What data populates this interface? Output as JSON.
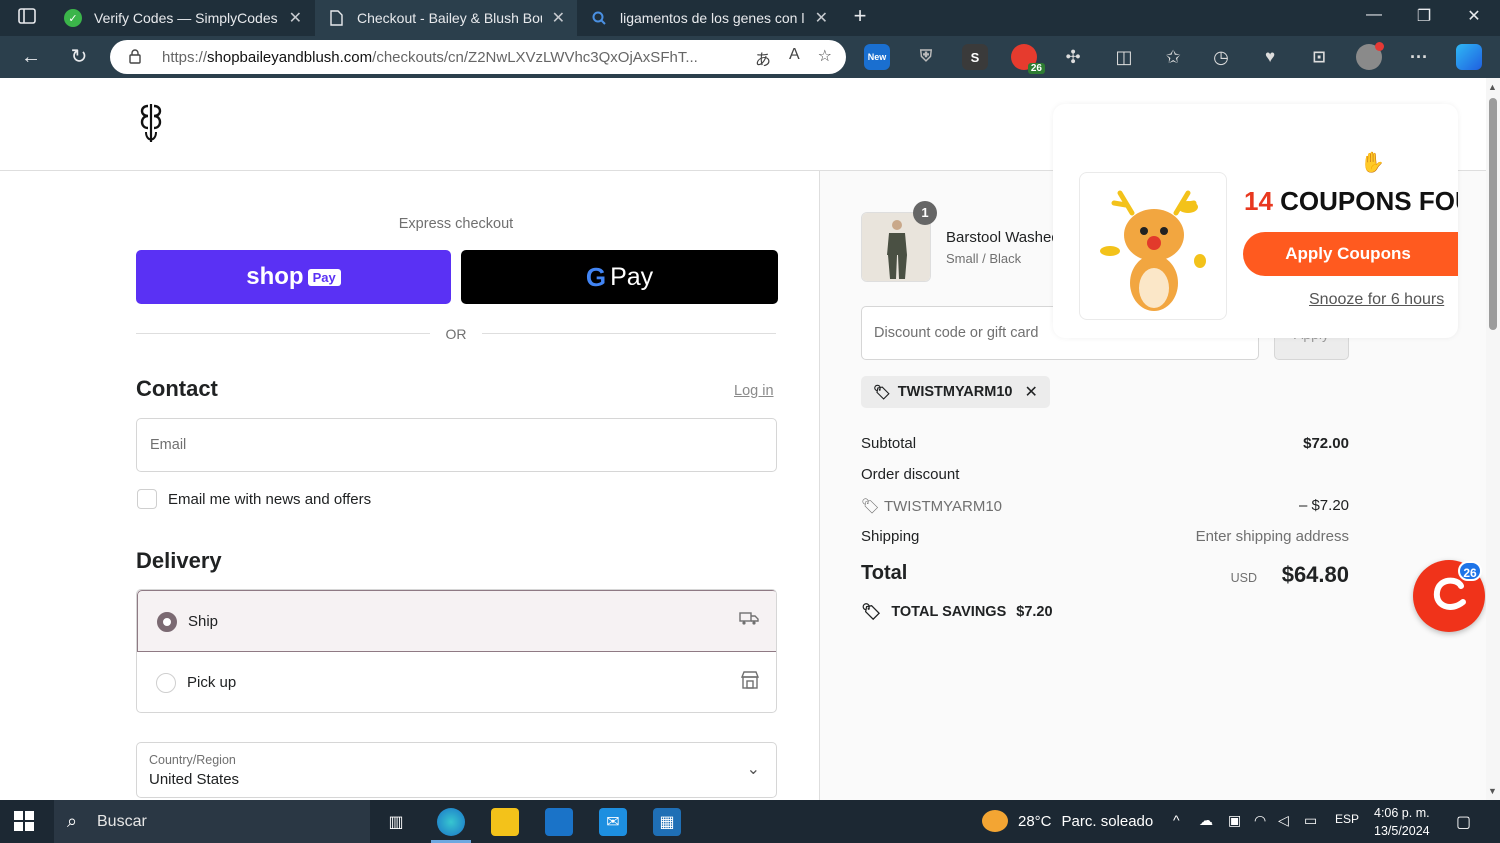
{
  "browser": {
    "tabs": [
      {
        "title": "Verify Codes — SimplyCodes",
        "icon": "simplycodes-icon"
      },
      {
        "title": "Checkout - Bailey & Blush Boutique",
        "icon": "page-icon"
      },
      {
        "title": "ligamentos de los genes con los",
        "icon": "search-icon"
      }
    ],
    "url_prefix": "https://",
    "url_domain": "shopbaileyandblush.com",
    "url_path": "/checkouts/cn/Z2NwLXVzLWVhc3QxOjAxSFhT...",
    "extension_badges": {
      "new": "New",
      "count": "26",
      "s_label": "S"
    }
  },
  "checkout": {
    "express_label": "Express checkout",
    "shop_pay_label": "shop",
    "shop_pay_badge": "Pay",
    "gpay_g": "G",
    "gpay_label": "Pay",
    "or_label": "OR",
    "contact_title": "Contact",
    "login_label": "Log in",
    "email_placeholder": "Email",
    "newsletter_label": "Email me with news and offers",
    "delivery_title": "Delivery",
    "ship_label": "Ship",
    "pickup_label": "Pick up",
    "country_label": "Country/Region",
    "country_value": "United States"
  },
  "summary": {
    "qty": "1",
    "product_name": "Barstool Washed",
    "product_variant": "Small / Black",
    "discount_placeholder": "Discount code or gift card",
    "apply_label": "Apply",
    "code": "TWISTMYARM10",
    "subtotal_label": "Subtotal",
    "subtotal_value": "$72.00",
    "order_discount_label": "Order discount",
    "discount_code_label": "TWISTMYARM10",
    "discount_value": "– $7.20",
    "shipping_label": "Shipping",
    "shipping_value": "Enter shipping address",
    "total_label": "Total",
    "currency": "USD",
    "total_value": "$64.80",
    "savings_label": "TOTAL SAVINGS",
    "savings_value": "$7.20"
  },
  "coupon_popup": {
    "count": "14",
    "title_rest": "COUPONS FOUND",
    "apply_label": "Apply Coupons",
    "snooze_label": "Snooze for 6 hours"
  },
  "fab": {
    "badge": "26"
  },
  "taskbar": {
    "search_placeholder": "Buscar",
    "weather_temp": "28°C",
    "weather_desc": "Parc. soleado",
    "lang": "ESP",
    "time": "4:06 p. m.",
    "date": "13/5/2024"
  },
  "colors": {
    "shop_pay": "#5a31f4",
    "coupon_accent": "#ff5a1f",
    "tab_bar": "#1f2f3a"
  }
}
